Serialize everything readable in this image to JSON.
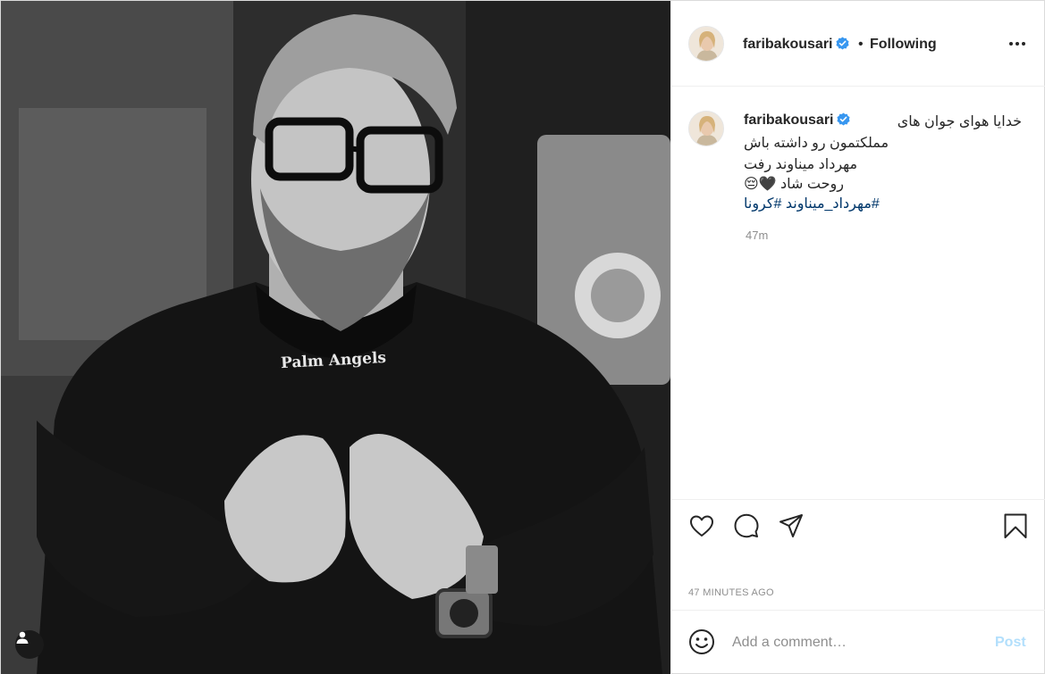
{
  "header": {
    "username": "faribakousari",
    "verified_icon": "verified-badge-icon",
    "separator": "•",
    "follow_status": "Following",
    "more_icon": "more-options-icon"
  },
  "caption": {
    "username": "faribakousari",
    "lines": [
      "خدایا هوای جوان های",
      "مملکتمون رو داشته باش",
      "مهرداد میناوند رفت",
      "😔🖤 روحت شاد",
      "مهرداد_میناوند #کرونا#"
    ],
    "relative_time": "47m"
  },
  "photo": {
    "shirt_print": "Palm Angels",
    "tag_icon": "tagged-user-icon"
  },
  "actions": {
    "like_icon": "heart-icon",
    "comment_icon": "comment-icon",
    "share_icon": "share-icon",
    "save_icon": "bookmark-icon",
    "timestamp": "47 MINUTES AGO"
  },
  "comment_box": {
    "emoji_icon": "emoji-icon",
    "placeholder": "Add a comment…",
    "post_label": "Post"
  },
  "colors": {
    "text": "#262626",
    "muted": "#8e8e8e",
    "link": "#00376b",
    "verified": "#3897f0",
    "post_disabled": "#b2dffc",
    "border": "#efefef"
  }
}
